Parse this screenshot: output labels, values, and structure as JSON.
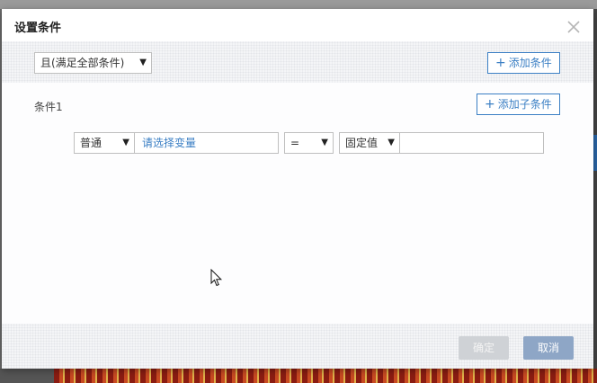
{
  "dialog": {
    "title": "设置条件",
    "close_icon": "close-icon"
  },
  "top_bar": {
    "logic_select": "且(满足全部条件)",
    "add_condition_label": "添加条件"
  },
  "condition": {
    "label": "条件1",
    "add_sub_condition_label": "添加子条件",
    "type_select": "普通",
    "variable_placeholder": "请选择变量",
    "operator_select": "=",
    "value_type_select": "固定值",
    "value_input": ""
  },
  "footer": {
    "confirm_label": "确定",
    "cancel_label": "取消"
  },
  "colors": {
    "accent": "#3b7fc4",
    "cancel_button": "#8ea6c6",
    "confirm_button_disabled": "#cfd2d6"
  }
}
